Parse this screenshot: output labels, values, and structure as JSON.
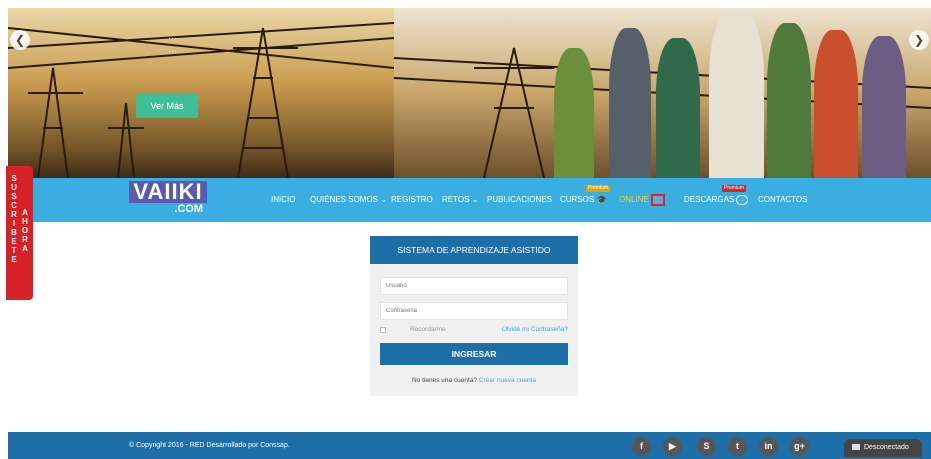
{
  "hero": {
    "caption_line1": "...",
    "caption_line2": "...",
    "cta_label": "Ver Más",
    "prev_icon": "chevron-left-icon",
    "next_icon": "chevron-right-icon"
  },
  "nav": {
    "logo_top": "VAIIKI",
    "logo_bottom": ".COM",
    "items": [
      {
        "label": "INICIO"
      },
      {
        "label": "QUIÉNES SOMOS",
        "dropdown": true
      },
      {
        "label": "REGISTRO"
      },
      {
        "label": "RETOS",
        "dropdown": true
      },
      {
        "label": "PUBLICACIONES"
      },
      {
        "label": "CURSOS",
        "badge": "Premium"
      },
      {
        "label": "ONLINE"
      },
      {
        "label": "DESCARGAS",
        "badge": "Premium"
      },
      {
        "label": "CONTACTOS"
      }
    ],
    "chevron": "⌄",
    "colors": {
      "bar": "#3aaee0",
      "online": "#ffd400",
      "premium_orange": "#e6a300",
      "premium_red": "#d4282e"
    }
  },
  "subscribe": {
    "col1": "SUSCRIBETE",
    "col2": "AHORA",
    "color": "#d62226"
  },
  "login": {
    "title": "SISTEMA DE APRENDIZAJE ASISTIDO",
    "user_placeholder": "Usuario",
    "pass_placeholder": "Contraseña",
    "remember_label": "Recordarme",
    "forgot_label": "Olvidé mi Contraseña?",
    "submit_label": "INGRESAR",
    "no_account_text": "No tienes una cuenta?",
    "create_link": "Crear nueva cuenta",
    "accent": "#1e6fa8",
    "link_color": "#38a9d8"
  },
  "footer": {
    "copyright": "© Copyright 2016 - RED Desarrollado por Conssap.",
    "social": [
      {
        "glyph": "f",
        "icon": "facebook-icon"
      },
      {
        "glyph": "▶",
        "icon": "youtube-icon"
      },
      {
        "glyph": "S",
        "icon": "skype-icon"
      },
      {
        "glyph": "t",
        "icon": "twitter-icon"
      },
      {
        "glyph": "in",
        "icon": "linkedin-icon"
      },
      {
        "glyph": "g+",
        "icon": "google-plus-icon"
      }
    ],
    "chat_label": "Desconectado"
  }
}
